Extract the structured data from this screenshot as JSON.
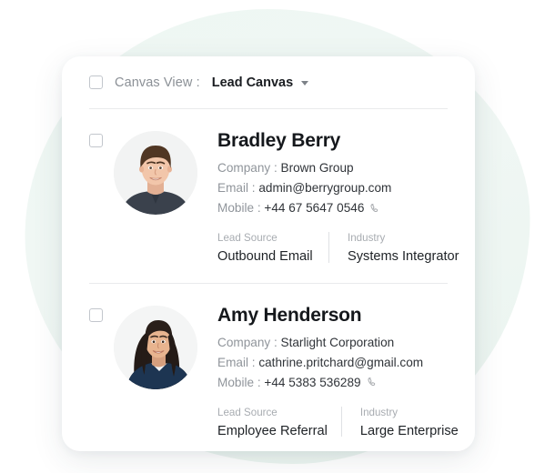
{
  "header": {
    "checkbox_name": "select-all-checkbox",
    "label": "Canvas View :",
    "selected_view": "Lead Canvas",
    "caret_icon": "chevron-down-icon"
  },
  "labels": {
    "company": "Company :",
    "email": "Email :",
    "mobile": "Mobile :",
    "lead_source": "Lead Source",
    "industry": "Industry",
    "phone_icon": "phone-handset-icon"
  },
  "leads": [
    {
      "name": "Bradley Berry",
      "company": "Brown Group",
      "email": "admin@berrygroup.com",
      "mobile": "+44 67 5647 0546",
      "lead_source": "Outbound Email",
      "industry": "Systems Integrator",
      "avatar_alt": "avatar-bradley-berry"
    },
    {
      "name": "Amy Henderson",
      "company": "Starlight Corporation",
      "email": "cathrine.pritchard@gmail.com",
      "mobile": "+44 5383 536289",
      "lead_source": "Employee Referral",
      "industry": "Large Enterprise",
      "avatar_alt": "avatar-amy-henderson"
    }
  ],
  "colors": {
    "card_background": "#ffffff",
    "blob_mint": "#eef7f3",
    "page_background": "#ffffff",
    "text_primary": "#15181c",
    "text_muted": "#90959b",
    "divider": "#e9eaec"
  }
}
